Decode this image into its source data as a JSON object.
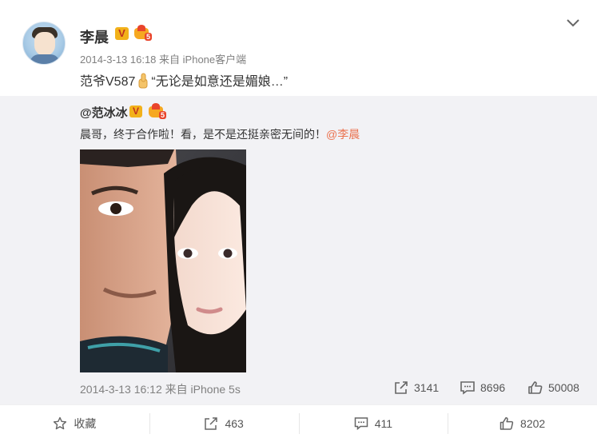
{
  "post": {
    "author": "李晨",
    "timestamp": "2014-3-13 16:18",
    "source": "来自 iPhone客户端",
    "text_before": "范爷V587",
    "text_after": "“无论是如意还是媚娘…”",
    "level": "5"
  },
  "repost": {
    "author": "@范冰冰",
    "text": "晨哥，终于合作啦！看，是不是还挺亲密无间的！",
    "mention": "@李晨",
    "timestamp": "2014-3-13 16:12",
    "source": "来自 iPhone 5s",
    "level": "5",
    "stats": {
      "forward": "3141",
      "comment": "8696",
      "like": "50008"
    }
  },
  "actions": {
    "favorite": "收藏",
    "forward": "463",
    "comment": "411",
    "like": "8202"
  },
  "icons": {
    "verified": "V",
    "thumb": "thumbs-up-emoji",
    "chevron": "chevron-down-icon"
  },
  "colors": {
    "mention": "#eb7350",
    "verified_badge": "#f2b11a",
    "repost_bg": "#f2f2f5"
  }
}
